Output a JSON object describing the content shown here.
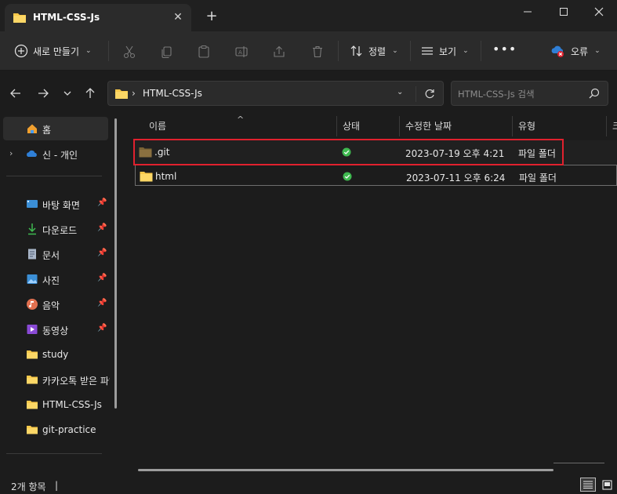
{
  "window": {
    "tab_title": "HTML-CSS-Js",
    "new_tab_glyph": "+",
    "close_tab_glyph": "✕",
    "min_glyph": "—",
    "max_glyph": "☐",
    "close_glyph": "✕"
  },
  "toolbar": {
    "new_label": "새로 만들기",
    "sort_label": "정렬",
    "view_label": "보기",
    "more_label": "•••",
    "error_label": "오류",
    "icons": [
      "cut-icon",
      "copy-icon",
      "paste-icon",
      "rename-icon",
      "share-icon",
      "delete-icon"
    ]
  },
  "address": {
    "crumb": "HTML-CSS-Js",
    "search_placeholder": "HTML-CSS-Js 검색"
  },
  "sidebar": {
    "items": [
      {
        "label": "홈",
        "icon": "home-icon"
      },
      {
        "label": "신 - 개인",
        "icon": "onedrive-icon"
      },
      {
        "label": "바탕 화면",
        "icon": "desktop-icon",
        "pinned": true
      },
      {
        "label": "다운로드",
        "icon": "download-icon",
        "pinned": true
      },
      {
        "label": "문서",
        "icon": "document-icon",
        "pinned": true
      },
      {
        "label": "사진",
        "icon": "pictures-icon",
        "pinned": true
      },
      {
        "label": "음악",
        "icon": "music-icon",
        "pinned": true
      },
      {
        "label": "동영상",
        "icon": "video-icon",
        "pinned": true
      },
      {
        "label": "study",
        "icon": "folder-icon"
      },
      {
        "label": "카카오톡 받은 파일",
        "icon": "folder-icon"
      },
      {
        "label": "HTML-CSS-Js",
        "icon": "folder-icon"
      },
      {
        "label": "git-practice",
        "icon": "folder-icon"
      }
    ]
  },
  "columns": {
    "name": "이름",
    "status": "상태",
    "modified": "수정한 날짜",
    "type": "유형",
    "size": "크"
  },
  "files": [
    {
      "name": ".git",
      "modified": "2023-07-19 오후 4:21",
      "type": "파일 폴더",
      "status": "synced"
    },
    {
      "name": "html",
      "modified": "2023-07-11 오후 6:24",
      "type": "파일 폴더",
      "status": "synced"
    }
  ],
  "status": {
    "count_text": "2개 항목",
    "divider": "|"
  },
  "colors": {
    "folder": "#f8c84a",
    "git_folder": "#8a7040",
    "highlight": "#e0212e",
    "sync_ok": "#3fb950"
  }
}
